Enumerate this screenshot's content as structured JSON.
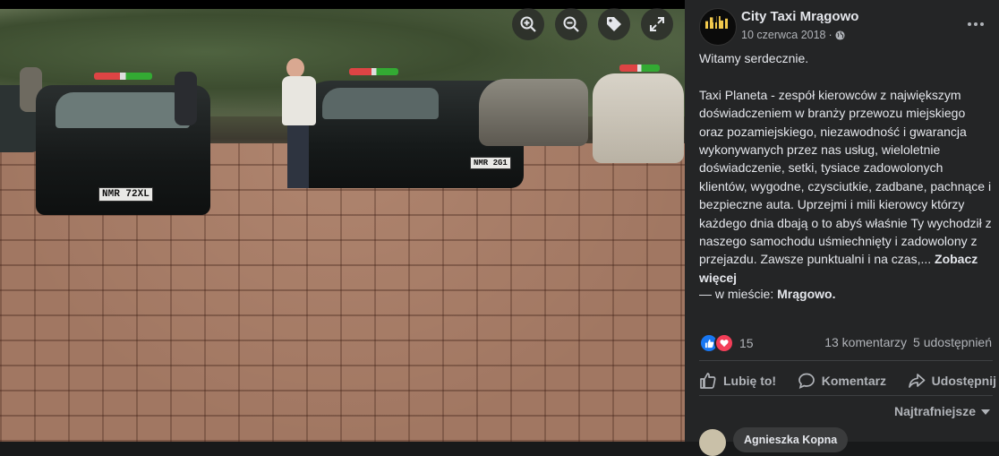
{
  "viewer": {
    "tools": {
      "zoom_in": "zoom-in-icon",
      "zoom_out": "zoom-out-icon",
      "tag": "tag-icon",
      "fullscreen": "fullscreen-icon"
    },
    "photo_plates": [
      "NMR 72XL",
      "NMR 2G1"
    ]
  },
  "post": {
    "page_name": "City Taxi Mrągowo",
    "avatar_text": "City Taxi Mrągowo",
    "date": "10 czerwca 2018",
    "date_separator": "·",
    "audience_icon": "globe-icon",
    "paragraph1": "Witamy serdecznie.",
    "paragraph2": "Taxi Planeta - zespół kierowców z największym doświadczeniem w branży przewozu miejskiego oraz pozamiejskiego, niezawodność i gwarancja wykonywanych przez nas usług, wieloletnie doświadczenie, setki, tysiace zadowolonych klientów, wygodne, czysciutkie, zadbane, pachnące i bezpieczne auta. Uprzejmi i mili kierowcy którzy każdego dnia dbają o to abyś właśnie Ty wychodził z naszego samochodu uśmiechnięty i zadowolony z przejazdu. Zawsze punktualni i na czas,...",
    "see_more": "Zobacz więcej",
    "location_prefix": "— w mieście:",
    "location_name": "Mrągowo."
  },
  "engagement": {
    "reaction_count": "15",
    "comments": "13 komentarzy",
    "shares": "5 udostępnień"
  },
  "actions": {
    "like": "Lubię to!",
    "comment": "Komentarz",
    "share": "Udostępnij"
  },
  "comments_section": {
    "sort_label": "Najtrafniejsze",
    "first_commenter": "Agnieszka Kopna"
  },
  "colors": {
    "panel_bg": "#242526",
    "text_primary": "#e4e6eb",
    "text_secondary": "#b0b3b8",
    "like_blue": "#1877f2",
    "love_red": "#f33e58"
  }
}
